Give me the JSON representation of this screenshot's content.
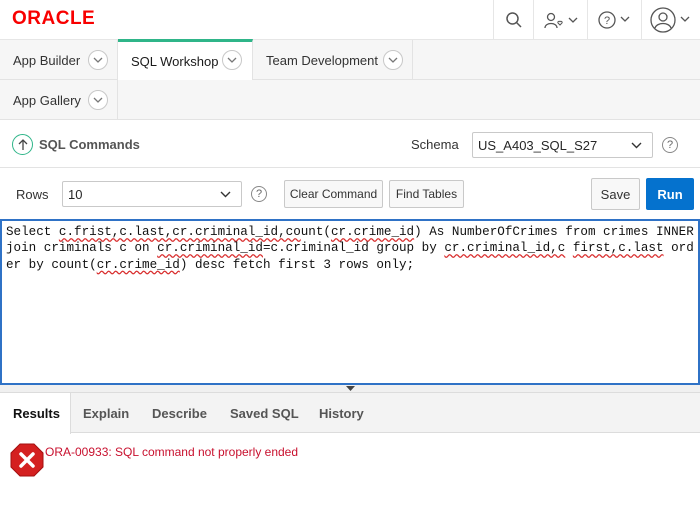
{
  "header": {
    "logo_text": "ORACLE",
    "icons": [
      "search-icon",
      "user-heart-icon",
      "help-icon",
      "user-avatar-icon"
    ]
  },
  "nav": {
    "tabs": [
      {
        "label": "App Builder",
        "active": false
      },
      {
        "label": "SQL Workshop",
        "active": true
      },
      {
        "label": "Team Development",
        "active": false
      },
      {
        "label": "App Gallery",
        "active": false
      }
    ],
    "accent_color": "#2fb589"
  },
  "section": {
    "title": "SQL Commands",
    "schema_label": "Schema",
    "schema_value": "US_A403_SQL_S27"
  },
  "toolbar": {
    "rows_label": "Rows",
    "rows_value": "10",
    "clear_label": "Clear Command",
    "find_label": "Find Tables",
    "save_label": "Save",
    "run_label": "Run",
    "run_color": "#0572ce"
  },
  "editor": {
    "segments": [
      {
        "t": "Select ",
        "err": false
      },
      {
        "t": "c.frist,c.last,cr.criminal_id,co",
        "err": true
      },
      {
        "t": "unt(",
        "err": false
      },
      {
        "t": "cr.crime_id",
        "err": true
      },
      {
        "t": ") As NumberOfCrimes from crimes INNER join criminals c on ",
        "err": false
      },
      {
        "t": "cr.criminal_id",
        "err": true
      },
      {
        "t": "=c.criminal_id group by ",
        "err": false
      },
      {
        "t": "cr.criminal_id,c",
        "err": true
      },
      {
        "t": " ",
        "err": false
      },
      {
        "t": "first,c.last",
        "err": true
      },
      {
        "t": " order by count(",
        "err": false
      },
      {
        "t": "cr.crime_id",
        "err": true
      },
      {
        "t": ") desc fetch first 3 rows only;",
        "err": false
      }
    ]
  },
  "results": {
    "tabs": [
      "Results",
      "Explain",
      "Describe",
      "Saved SQL",
      "History"
    ],
    "active_tab": "Results",
    "error_message": "ORA-00933: SQL command not properly ended",
    "error_color": "#c8102e"
  }
}
